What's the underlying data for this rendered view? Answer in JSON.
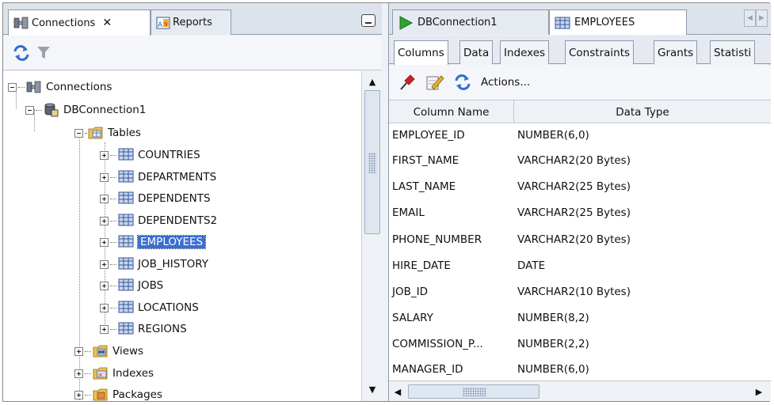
{
  "left_panel": {
    "tabs": [
      {
        "label": "Connections",
        "icon": "connections-icon",
        "active": true,
        "closable": true
      },
      {
        "label": "Reports",
        "icon": "reports-icon",
        "active": false,
        "closable": false
      }
    ],
    "tree": {
      "root": {
        "label": "Connections",
        "icon": "connections-icon"
      },
      "connection": {
        "label": "DBConnection1",
        "icon": "database-icon"
      },
      "tables_folder": {
        "label": "Tables",
        "icon": "folder-tables-icon"
      },
      "tables": [
        "COUNTRIES",
        "DEPARTMENTS",
        "DEPENDENTS",
        "DEPENDENTS2",
        "EMPLOYEES",
        "JOB_HISTORY",
        "JOBS",
        "LOCATIONS",
        "REGIONS"
      ],
      "selected_table": "EMPLOYEES",
      "folders": [
        {
          "label": "Views",
          "icon": "views-folder-icon"
        },
        {
          "label": "Indexes",
          "icon": "indexes-folder-icon"
        },
        {
          "label": "Packages",
          "icon": "packages-folder-icon"
        }
      ]
    }
  },
  "right_panel": {
    "editor_tabs": [
      {
        "label": "DBConnection1",
        "icon": "run-icon"
      },
      {
        "label": "EMPLOYEES",
        "icon": "table-icon",
        "active": true
      }
    ],
    "sub_tabs": [
      "Columns",
      "Data",
      "Indexes",
      "Constraints",
      "Grants",
      "Statisti"
    ],
    "active_sub_tab": "Columns",
    "actions_label": "Actions...",
    "columns_header": {
      "name": "Column Name",
      "type": "Data Type"
    },
    "rows": [
      {
        "name": "EMPLOYEE_ID",
        "type": "NUMBER(6,0)"
      },
      {
        "name": "FIRST_NAME",
        "type": "VARCHAR2(20 Bytes)"
      },
      {
        "name": "LAST_NAME",
        "type": "VARCHAR2(25 Bytes)"
      },
      {
        "name": "EMAIL",
        "type": "VARCHAR2(25 Bytes)"
      },
      {
        "name": "PHONE_NUMBER",
        "type": "VARCHAR2(20 Bytes)"
      },
      {
        "name": "HIRE_DATE",
        "type": "DATE"
      },
      {
        "name": "JOB_ID",
        "type": "VARCHAR2(10 Bytes)"
      },
      {
        "name": "SALARY",
        "type": "NUMBER(8,2)"
      },
      {
        "name": "COMMISSION_P...",
        "type": "NUMBER(2,2)"
      },
      {
        "name": "MANAGER_ID",
        "type": "NUMBER(6,0)"
      }
    ]
  },
  "colors": {
    "selection": "#3a6ed0",
    "tab_bg": "#dde3ea",
    "run_green": "#2fa52f"
  }
}
